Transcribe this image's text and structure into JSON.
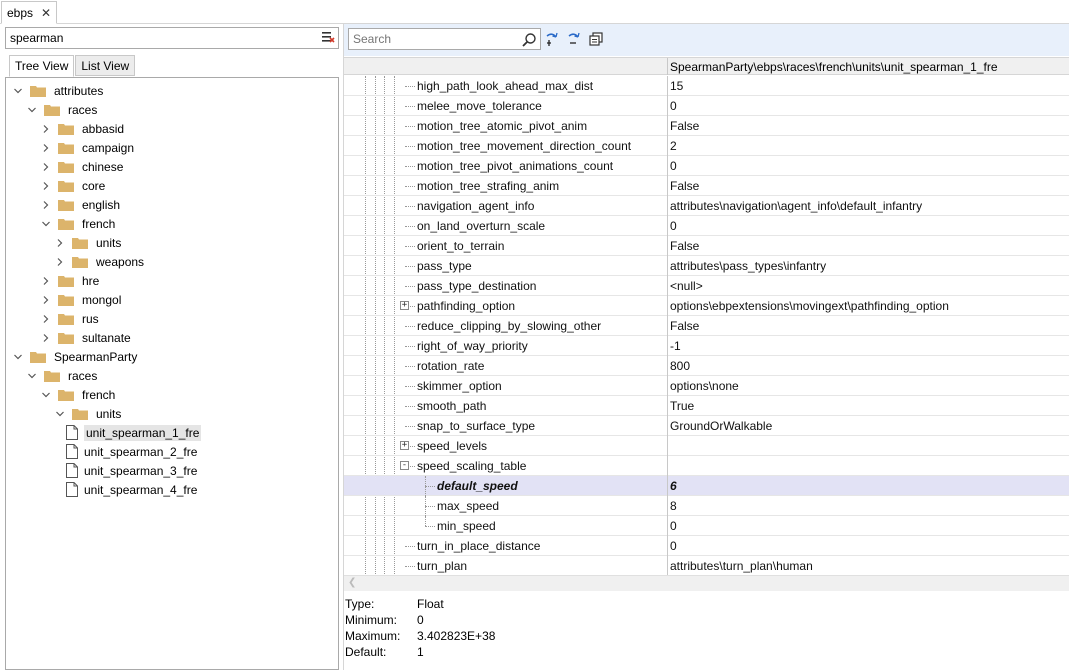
{
  "doc_tab": {
    "label": "ebps",
    "close": "✕"
  },
  "left": {
    "filter_value": "spearman",
    "tabs": [
      {
        "label": "Tree View",
        "active": true
      },
      {
        "label": "List View",
        "active": false
      }
    ],
    "tree": [
      {
        "label": "attributes",
        "depth": 0,
        "expanded": true,
        "kind": "folder"
      },
      {
        "label": "races",
        "depth": 1,
        "expanded": true,
        "kind": "folder"
      },
      {
        "label": "abbasid",
        "depth": 2,
        "expanded": false,
        "kind": "folder"
      },
      {
        "label": "campaign",
        "depth": 2,
        "expanded": false,
        "kind": "folder"
      },
      {
        "label": "chinese",
        "depth": 2,
        "expanded": false,
        "kind": "folder"
      },
      {
        "label": "core",
        "depth": 2,
        "expanded": false,
        "kind": "folder"
      },
      {
        "label": "english",
        "depth": 2,
        "expanded": false,
        "kind": "folder"
      },
      {
        "label": "french",
        "depth": 2,
        "expanded": true,
        "kind": "folder"
      },
      {
        "label": "units",
        "depth": 3,
        "expanded": false,
        "kind": "folder"
      },
      {
        "label": "weapons",
        "depth": 3,
        "expanded": false,
        "kind": "folder"
      },
      {
        "label": "hre",
        "depth": 2,
        "expanded": false,
        "kind": "folder"
      },
      {
        "label": "mongol",
        "depth": 2,
        "expanded": false,
        "kind": "folder"
      },
      {
        "label": "rus",
        "depth": 2,
        "expanded": false,
        "kind": "folder"
      },
      {
        "label": "sultanate",
        "depth": 2,
        "expanded": false,
        "kind": "folder"
      },
      {
        "label": "SpearmanParty",
        "depth": 0,
        "expanded": true,
        "kind": "folder"
      },
      {
        "label": "races",
        "depth": 1,
        "expanded": true,
        "kind": "folder"
      },
      {
        "label": "french",
        "depth": 2,
        "expanded": true,
        "kind": "folder"
      },
      {
        "label": "units",
        "depth": 3,
        "expanded": true,
        "kind": "folder"
      },
      {
        "label": "unit_spearman_1_fre",
        "depth": 4,
        "kind": "file",
        "selected": true
      },
      {
        "label": "unit_spearman_2_fre",
        "depth": 4,
        "kind": "file"
      },
      {
        "label": "unit_spearman_3_fre",
        "depth": 4,
        "kind": "file"
      },
      {
        "label": "unit_spearman_4_fre",
        "depth": 4,
        "kind": "file"
      }
    ]
  },
  "right": {
    "search_placeholder": "Search",
    "header_path": "SpearmanParty\\ebps\\races\\french\\units\\unit_spearman_1_fre",
    "rows": [
      {
        "name": "high_path_look_ahead_max_dist",
        "value": "15",
        "level": 0
      },
      {
        "name": "melee_move_tolerance",
        "value": "0",
        "level": 0
      },
      {
        "name": "motion_tree_atomic_pivot_anim",
        "value": "False",
        "level": 0
      },
      {
        "name": "motion_tree_movement_direction_count",
        "value": "2",
        "level": 0
      },
      {
        "name": "motion_tree_pivot_animations_count",
        "value": "0",
        "level": 0
      },
      {
        "name": "motion_tree_strafing_anim",
        "value": "False",
        "level": 0
      },
      {
        "name": "navigation_agent_info",
        "value": "attributes\\navigation\\agent_info\\default_infantry",
        "level": 0
      },
      {
        "name": "on_land_overturn_scale",
        "value": "0",
        "level": 0
      },
      {
        "name": "orient_to_terrain",
        "value": "False",
        "level": 0
      },
      {
        "name": "pass_type",
        "value": "attributes\\pass_types\\infantry",
        "level": 0
      },
      {
        "name": "pass_type_destination",
        "value": "<null>",
        "level": 0
      },
      {
        "name": "pathfinding_option",
        "value": "options\\ebpextensions\\movingext\\pathfinding_option",
        "level": 0,
        "expander": "+"
      },
      {
        "name": "reduce_clipping_by_slowing_other",
        "value": "False",
        "level": 0
      },
      {
        "name": "right_of_way_priority",
        "value": "-1",
        "level": 0
      },
      {
        "name": "rotation_rate",
        "value": "800",
        "level": 0
      },
      {
        "name": "skimmer_option",
        "value": "options\\none",
        "level": 0
      },
      {
        "name": "smooth_path",
        "value": "True",
        "level": 0
      },
      {
        "name": "snap_to_surface_type",
        "value": "GroundOrWalkable",
        "level": 0
      },
      {
        "name": "speed_levels",
        "value": "",
        "level": 0,
        "expander": "+"
      },
      {
        "name": "speed_scaling_table",
        "value": "",
        "level": 0,
        "expander": "-"
      },
      {
        "name": "default_speed",
        "value": "6",
        "level": 1,
        "selected": true
      },
      {
        "name": "max_speed",
        "value": "8",
        "level": 1
      },
      {
        "name": "min_speed",
        "value": "0",
        "level": 1
      },
      {
        "name": "turn_in_place_distance",
        "value": "0",
        "level": 0
      },
      {
        "name": "turn_plan",
        "value": "attributes\\turn_plan\\human",
        "level": 0
      }
    ],
    "info": [
      {
        "key": "Type:",
        "value": "Float"
      },
      {
        "key": "Minimum:",
        "value": "0"
      },
      {
        "key": "Maximum:",
        "value": "3.402823E+38"
      },
      {
        "key": "Default:",
        "value": "1"
      }
    ]
  },
  "icons": {
    "close": "close-icon",
    "clear_filter": "clear-filter-icon",
    "search": "search-icon",
    "expand_all": "expand-all-icon",
    "collapse_all": "collapse-all-icon",
    "copy": "copy-icon",
    "folder": "folder-icon",
    "file": "file-icon"
  },
  "colors": {
    "toolbar_bg": "#e8f0fb",
    "selected_row_bg": "#e2e2f5",
    "folder": "#dcb46b"
  }
}
